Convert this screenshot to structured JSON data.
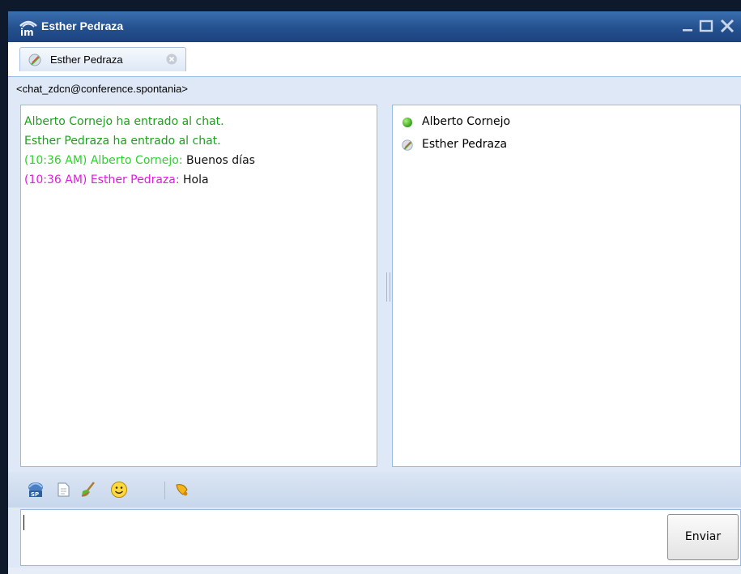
{
  "window": {
    "title": "Esther Pedraza"
  },
  "tab": {
    "label": "Esther Pedraza"
  },
  "room": {
    "label": "<chat_zdcn@conference.spontania>"
  },
  "chat": {
    "lines": [
      {
        "text": "Alberto Cornejo ha entrado al chat."
      },
      {
        "text": "Esther Pedraza ha entrado al chat."
      },
      {
        "prefix": "(10:36 AM) Alberto Cornejo:",
        "message": " Buenos días"
      },
      {
        "prefix": "(10:36 AM) Esther Pedraza:",
        "message": " Hola"
      }
    ]
  },
  "roster": {
    "items": [
      {
        "name": "Alberto Cornejo",
        "icon": "green-status-icon"
      },
      {
        "name": "Esther Pedraza",
        "icon": "feather-user-icon"
      }
    ]
  },
  "toolbar": {
    "icons": [
      "share-screen-icon",
      "document-icon",
      "brush-icon",
      "smiley-icon",
      "bell-icon"
    ]
  },
  "input": {
    "value": ""
  },
  "send": {
    "label": "Enviar"
  },
  "colors": {
    "system_message": "#1e9f1e",
    "other_user": "#2ed12e",
    "self_user": "#e11bde",
    "title_bar": "#24508e",
    "panel": "#dfe8f6"
  }
}
